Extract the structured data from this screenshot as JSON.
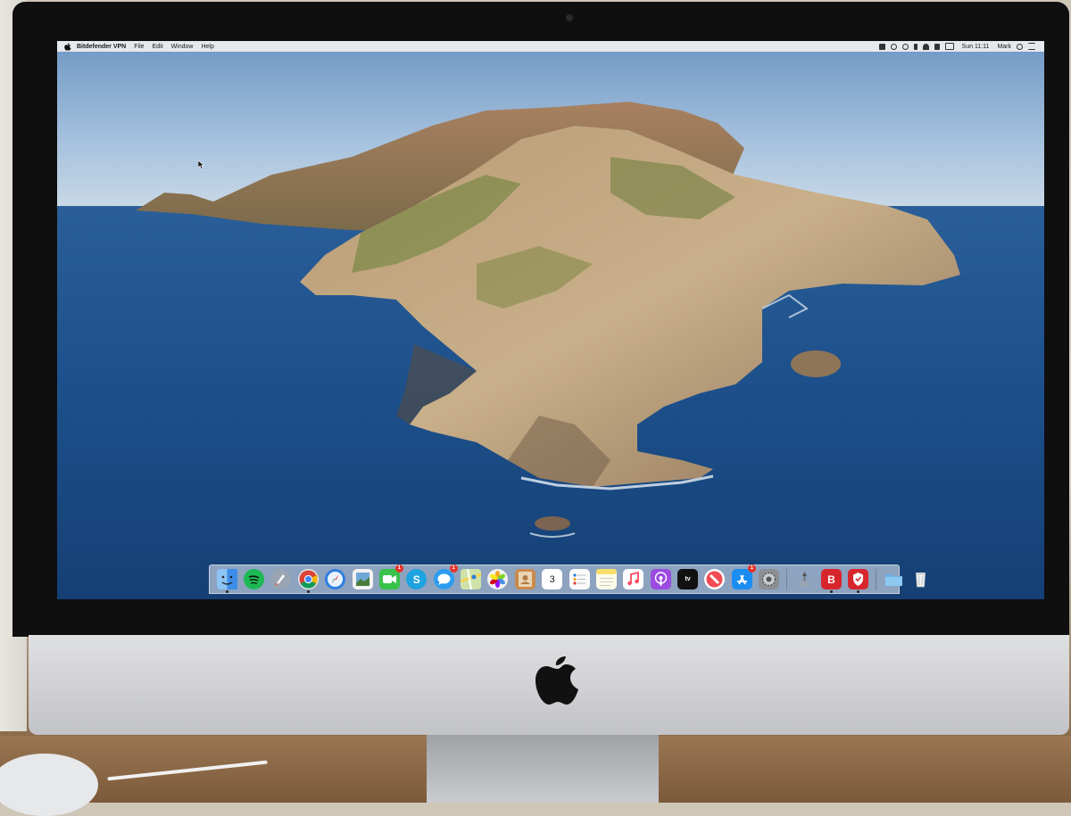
{
  "menubar": {
    "app_name": "Bitdefender VPN",
    "items": [
      "File",
      "Edit",
      "Window",
      "Help"
    ],
    "clock": "Sun 11:11",
    "user": "Mark"
  },
  "dock": {
    "apps": [
      {
        "name": "finder-icon",
        "color": "#3d8ee8"
      },
      {
        "name": "spotify-icon",
        "color": "#1db954"
      },
      {
        "name": "launchpad-icon",
        "color": "#9aa4b2"
      },
      {
        "name": "chrome-icon",
        "color": "#e9e9e9"
      },
      {
        "name": "safari-icon",
        "color": "#2f7ee0"
      },
      {
        "name": "preview-icon",
        "color": "#6fa7d9"
      },
      {
        "name": "facetime-icon",
        "color": "#39c24a",
        "badge": "1"
      },
      {
        "name": "skype-icon",
        "color": "#1ea3e0",
        "letter": "S"
      },
      {
        "name": "messages-icon",
        "color": "#2d9cf0",
        "badge": "1"
      },
      {
        "name": "maps-icon",
        "color": "#7cc46c"
      },
      {
        "name": "photos-icon",
        "color": "#f3f3f3"
      },
      {
        "name": "contacts-icon",
        "color": "#c98a4c"
      },
      {
        "name": "calendar-icon",
        "color": "#ffffff",
        "day": "3"
      },
      {
        "name": "reminders-icon",
        "color": "#fafafa"
      },
      {
        "name": "notes-icon",
        "color": "#f7df6a"
      },
      {
        "name": "music-icon",
        "color": "#fb4a61"
      },
      {
        "name": "podcasts-icon",
        "color": "#9b4be0"
      },
      {
        "name": "appletv-icon",
        "color": "#111111",
        "letter": "tv"
      },
      {
        "name": "news-icon",
        "color": "#f24b55"
      },
      {
        "name": "appstore-icon",
        "color": "#1c8df0",
        "badge": "1"
      },
      {
        "name": "system-preferences-icon",
        "color": "#8c8f94"
      },
      {
        "name": "utilities-icon",
        "color": "#cfd6e0"
      },
      {
        "name": "bitdefender-icon",
        "color": "#d8262d",
        "letter": "B"
      },
      {
        "name": "bitdefender-vpn-icon",
        "color": "#d8262d"
      },
      {
        "name": "downloads-folder-icon",
        "color": "#6cb4e8"
      },
      {
        "name": "trash-icon",
        "color": "#e4e6ea"
      }
    ]
  }
}
